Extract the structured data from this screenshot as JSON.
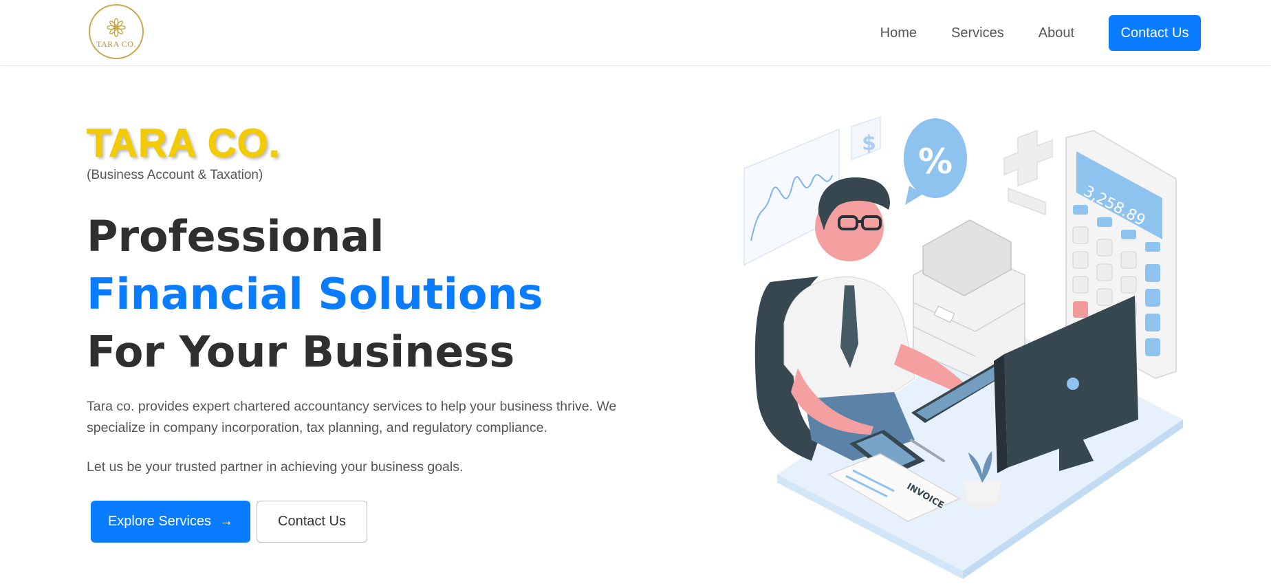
{
  "nav": {
    "logo_text": "TARA CO.",
    "links": [
      "Home",
      "Services",
      "About"
    ],
    "cta": "Contact Us"
  },
  "hero": {
    "brand": "TARA CO.",
    "brand_sub": "(Business Account & Taxation)",
    "headline_line1": "Professional",
    "headline_line2": "Financial Solutions",
    "headline_line3": "For Your Business",
    "description": "Tara co. provides expert chartered accountancy services to help your business thrive. We specialize in company incorporation, tax planning, and regulatory compliance.",
    "tagline": "Let us be your trusted partner in achieving your business goals.",
    "primary_button": "Explore Services",
    "primary_button_arrow": "→",
    "secondary_button": "Contact Us"
  },
  "illustration": {
    "calculator_display": "3,258.89",
    "invoice_label": "INVOICE",
    "percent_symbol": "%",
    "dollar_symbol": "$"
  },
  "colors": {
    "accent": "#0a7cff",
    "brand_yellow": "#f2cb05",
    "heading_dark": "#2f2f2f"
  }
}
